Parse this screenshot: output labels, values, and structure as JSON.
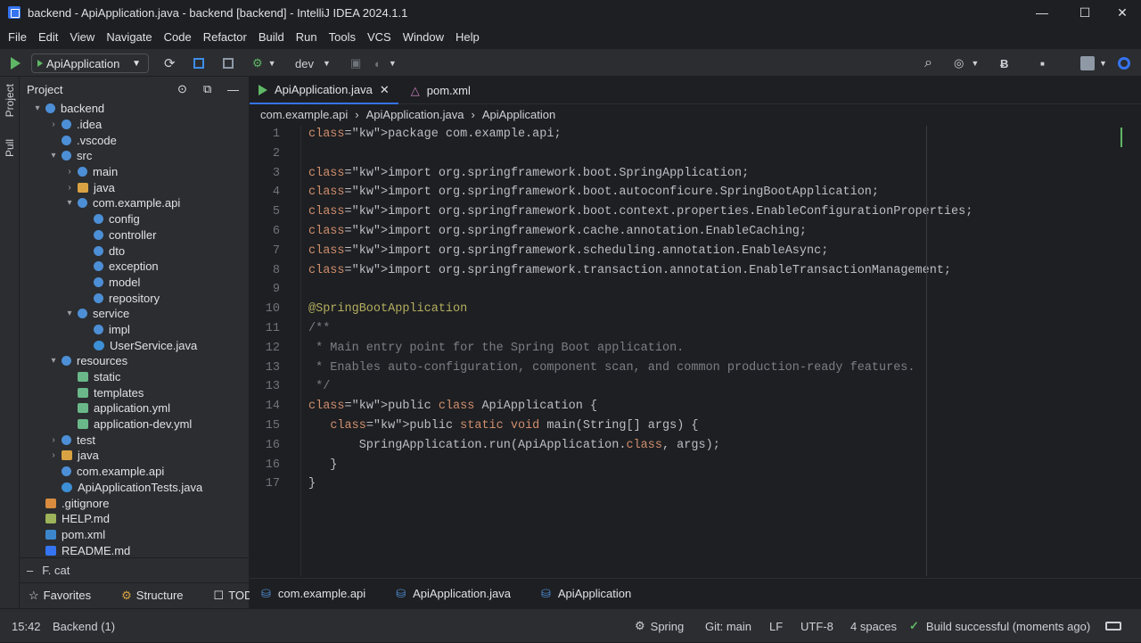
{
  "window": {
    "title": "backend - ApiApplication.java - backend [backend] - IntelliJ IDEA 2024.1.1",
    "minimize": "—",
    "maximize": "☐",
    "close": "✕"
  },
  "menu": [
    "File",
    "Edit",
    "View",
    "Navigate",
    "Code",
    "Refactor",
    "Build",
    "Run",
    "Tools",
    "VCS",
    "Window",
    "Help"
  ],
  "toolbar": {
    "run_config": "ApiApplication",
    "profile": "dev"
  },
  "left_strip": [
    "Project",
    "Pull"
  ],
  "project": {
    "title": "Project",
    "tree": [
      {
        "label": "backend",
        "depth": 0,
        "arrow": "▾",
        "icon": "pkg"
      },
      {
        "label": ".idea",
        "depth": 1,
        "arrow": "›",
        "icon": "pkg"
      },
      {
        "label": ".vscode",
        "depth": 1,
        "arrow": "",
        "icon": "pkg"
      },
      {
        "label": "src",
        "depth": 1,
        "arrow": "▾",
        "icon": "pkg"
      },
      {
        "label": "main",
        "depth": 2,
        "arrow": "›",
        "icon": "pkg"
      },
      {
        "label": "java",
        "depth": 2,
        "arrow": "›",
        "icon": "yellow"
      },
      {
        "label": "com.example.api",
        "depth": 2,
        "arrow": "▾",
        "icon": "pkg"
      },
      {
        "label": "config",
        "depth": 3,
        "arrow": "",
        "icon": "pkg"
      },
      {
        "label": "controller",
        "depth": 3,
        "arrow": "",
        "icon": "pkg"
      },
      {
        "label": "dto",
        "depth": 3,
        "arrow": "",
        "icon": "pkg"
      },
      {
        "label": "exception",
        "depth": 3,
        "arrow": "",
        "icon": "pkg"
      },
      {
        "label": "model",
        "depth": 3,
        "arrow": "",
        "icon": "pkg"
      },
      {
        "label": "repository",
        "depth": 3,
        "arrow": "",
        "icon": "pkg"
      },
      {
        "label": "service",
        "depth": 2,
        "arrow": "▾",
        "icon": "pkg"
      },
      {
        "label": "impl",
        "depth": 3,
        "arrow": "",
        "icon": "pkg"
      },
      {
        "label": "UserService.java",
        "depth": 3,
        "arrow": "",
        "icon": "java"
      },
      {
        "label": "resources",
        "depth": 1,
        "arrow": "▾",
        "icon": "pkg"
      },
      {
        "label": "static",
        "depth": 2,
        "arrow": "",
        "icon": "yml"
      },
      {
        "label": "templates",
        "depth": 2,
        "arrow": "",
        "icon": "yml"
      },
      {
        "label": "application.yml",
        "depth": 2,
        "arrow": "",
        "icon": "yml"
      },
      {
        "label": "application-dev.yml",
        "depth": 2,
        "arrow": "",
        "icon": "yml"
      },
      {
        "label": "test",
        "depth": 1,
        "arrow": "›",
        "icon": "pkg"
      },
      {
        "label": "java",
        "depth": 1,
        "arrow": "›",
        "icon": "yellow"
      },
      {
        "label": "com.example.api",
        "depth": 1,
        "arrow": "",
        "icon": "pkg"
      },
      {
        "label": "ApiApplicationTests.java",
        "depth": 1,
        "arrow": "",
        "icon": "java"
      },
      {
        "label": ".gitignore",
        "depth": 0,
        "arrow": "",
        "icon": "git"
      },
      {
        "label": "HELP.md",
        "depth": 0,
        "arrow": "",
        "icon": "md"
      },
      {
        "label": "pom.xml",
        "depth": 0,
        "arrow": "",
        "icon": "xml"
      },
      {
        "label": "README.md",
        "depth": 0,
        "arrow": "",
        "icon": "readme"
      }
    ],
    "filter": "F. cat",
    "bottom_tabs": [
      "Favorites",
      "Structure",
      "TODO"
    ]
  },
  "tabs": [
    {
      "label": "ApiApplication.java",
      "active": true
    },
    {
      "label": "pom.xml",
      "active": false
    }
  ],
  "breadcrumb": [
    "com.example.api",
    "ApiApplication.java",
    "ApiApplication"
  ],
  "code": [
    {
      "n": "1",
      "t": "package com.example.api;"
    },
    {
      "n": "2",
      "t": ""
    },
    {
      "n": "3",
      "t": "import org.springframework.boot.SpringApplication;"
    },
    {
      "n": "4",
      "t": "import org.springframework.boot.autoconficure.SpringBootApplication;"
    },
    {
      "n": "5",
      "t": "import org.springframework.boot.context.properties.EnableConfigurationProperties;"
    },
    {
      "n": "6",
      "t": "import org.springframework.cache.annotation.EnableCaching;"
    },
    {
      "n": "7",
      "t": "import org.springframework.scheduling.annotation.EnableAsync;"
    },
    {
      "n": "8",
      "t": "import org.springframework.transaction.annotation.EnableTransactionManagement;"
    },
    {
      "n": "9",
      "t": ""
    },
    {
      "n": "10",
      "t": "@SpringBootApplication"
    },
    {
      "n": "11",
      "t": "/**"
    },
    {
      "n": "12",
      "t": " * Main entry point for the Spring Boot application."
    },
    {
      "n": "13",
      "t": " * Enables auto-configuration, component scan, and common production-ready features."
    },
    {
      "n": "13",
      "t": " */"
    },
    {
      "n": "14",
      "t": "public class ApiApplication {"
    },
    {
      "n": "15",
      "t": "   public static void main(String[] args) {"
    },
    {
      "n": "16",
      "t": "       SpringApplication.run(ApiApplication.class, args);"
    },
    {
      "n": "16",
      "t": "   }"
    },
    {
      "n": "17",
      "t": "}"
    }
  ],
  "editor_bottom": [
    "com.example.api",
    "ApiApplication.java",
    "ApiApplication"
  ],
  "status": {
    "position": "15:42",
    "context": "Backend (1)",
    "spring": "Spring",
    "git": "Git: main",
    "line_sep": "LF",
    "encoding": "UTF-8",
    "indent": "4 spaces",
    "build": "Build successful (moments ago)"
  },
  "colors": {
    "accent": "#3574f0",
    "run_green": "#5fb865",
    "keyword": "#cf8e6d",
    "annotation": "#b3ae60",
    "comment": "#7a7e85"
  }
}
